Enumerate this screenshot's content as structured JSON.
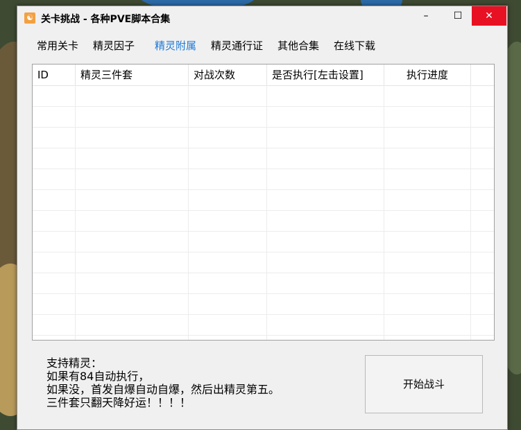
{
  "window": {
    "title": "关卡挑战 - 各种PVE脚本合集",
    "app_icon_glyph": "☯"
  },
  "controls": {
    "minimize": "–",
    "maximize": "☐",
    "close": "✕"
  },
  "menu": [
    {
      "label": "常用关卡",
      "active": false
    },
    {
      "label": "精灵因子",
      "active": false
    },
    {
      "label": "精灵附属",
      "active": true
    },
    {
      "label": "精灵通行证",
      "active": false
    },
    {
      "label": "其他合集",
      "active": false
    },
    {
      "label": "在线下载",
      "active": false
    }
  ],
  "table": {
    "columns": [
      "ID",
      "精灵三件套",
      "对战次数",
      "是否执行[左击设置]",
      "执行进度"
    ],
    "rows": []
  },
  "notes": {
    "line1": "支持精灵：",
    "line2": "如果有84自动执行，",
    "line3": "如果没，首发自爆自动自爆，然后出精灵第五。",
    "line4": "三件套只翻天降好运！！！！"
  },
  "start_button": {
    "label": "开始战斗"
  },
  "colors": {
    "active_tab": "#1e7ad6",
    "close_button": "#e81123"
  }
}
